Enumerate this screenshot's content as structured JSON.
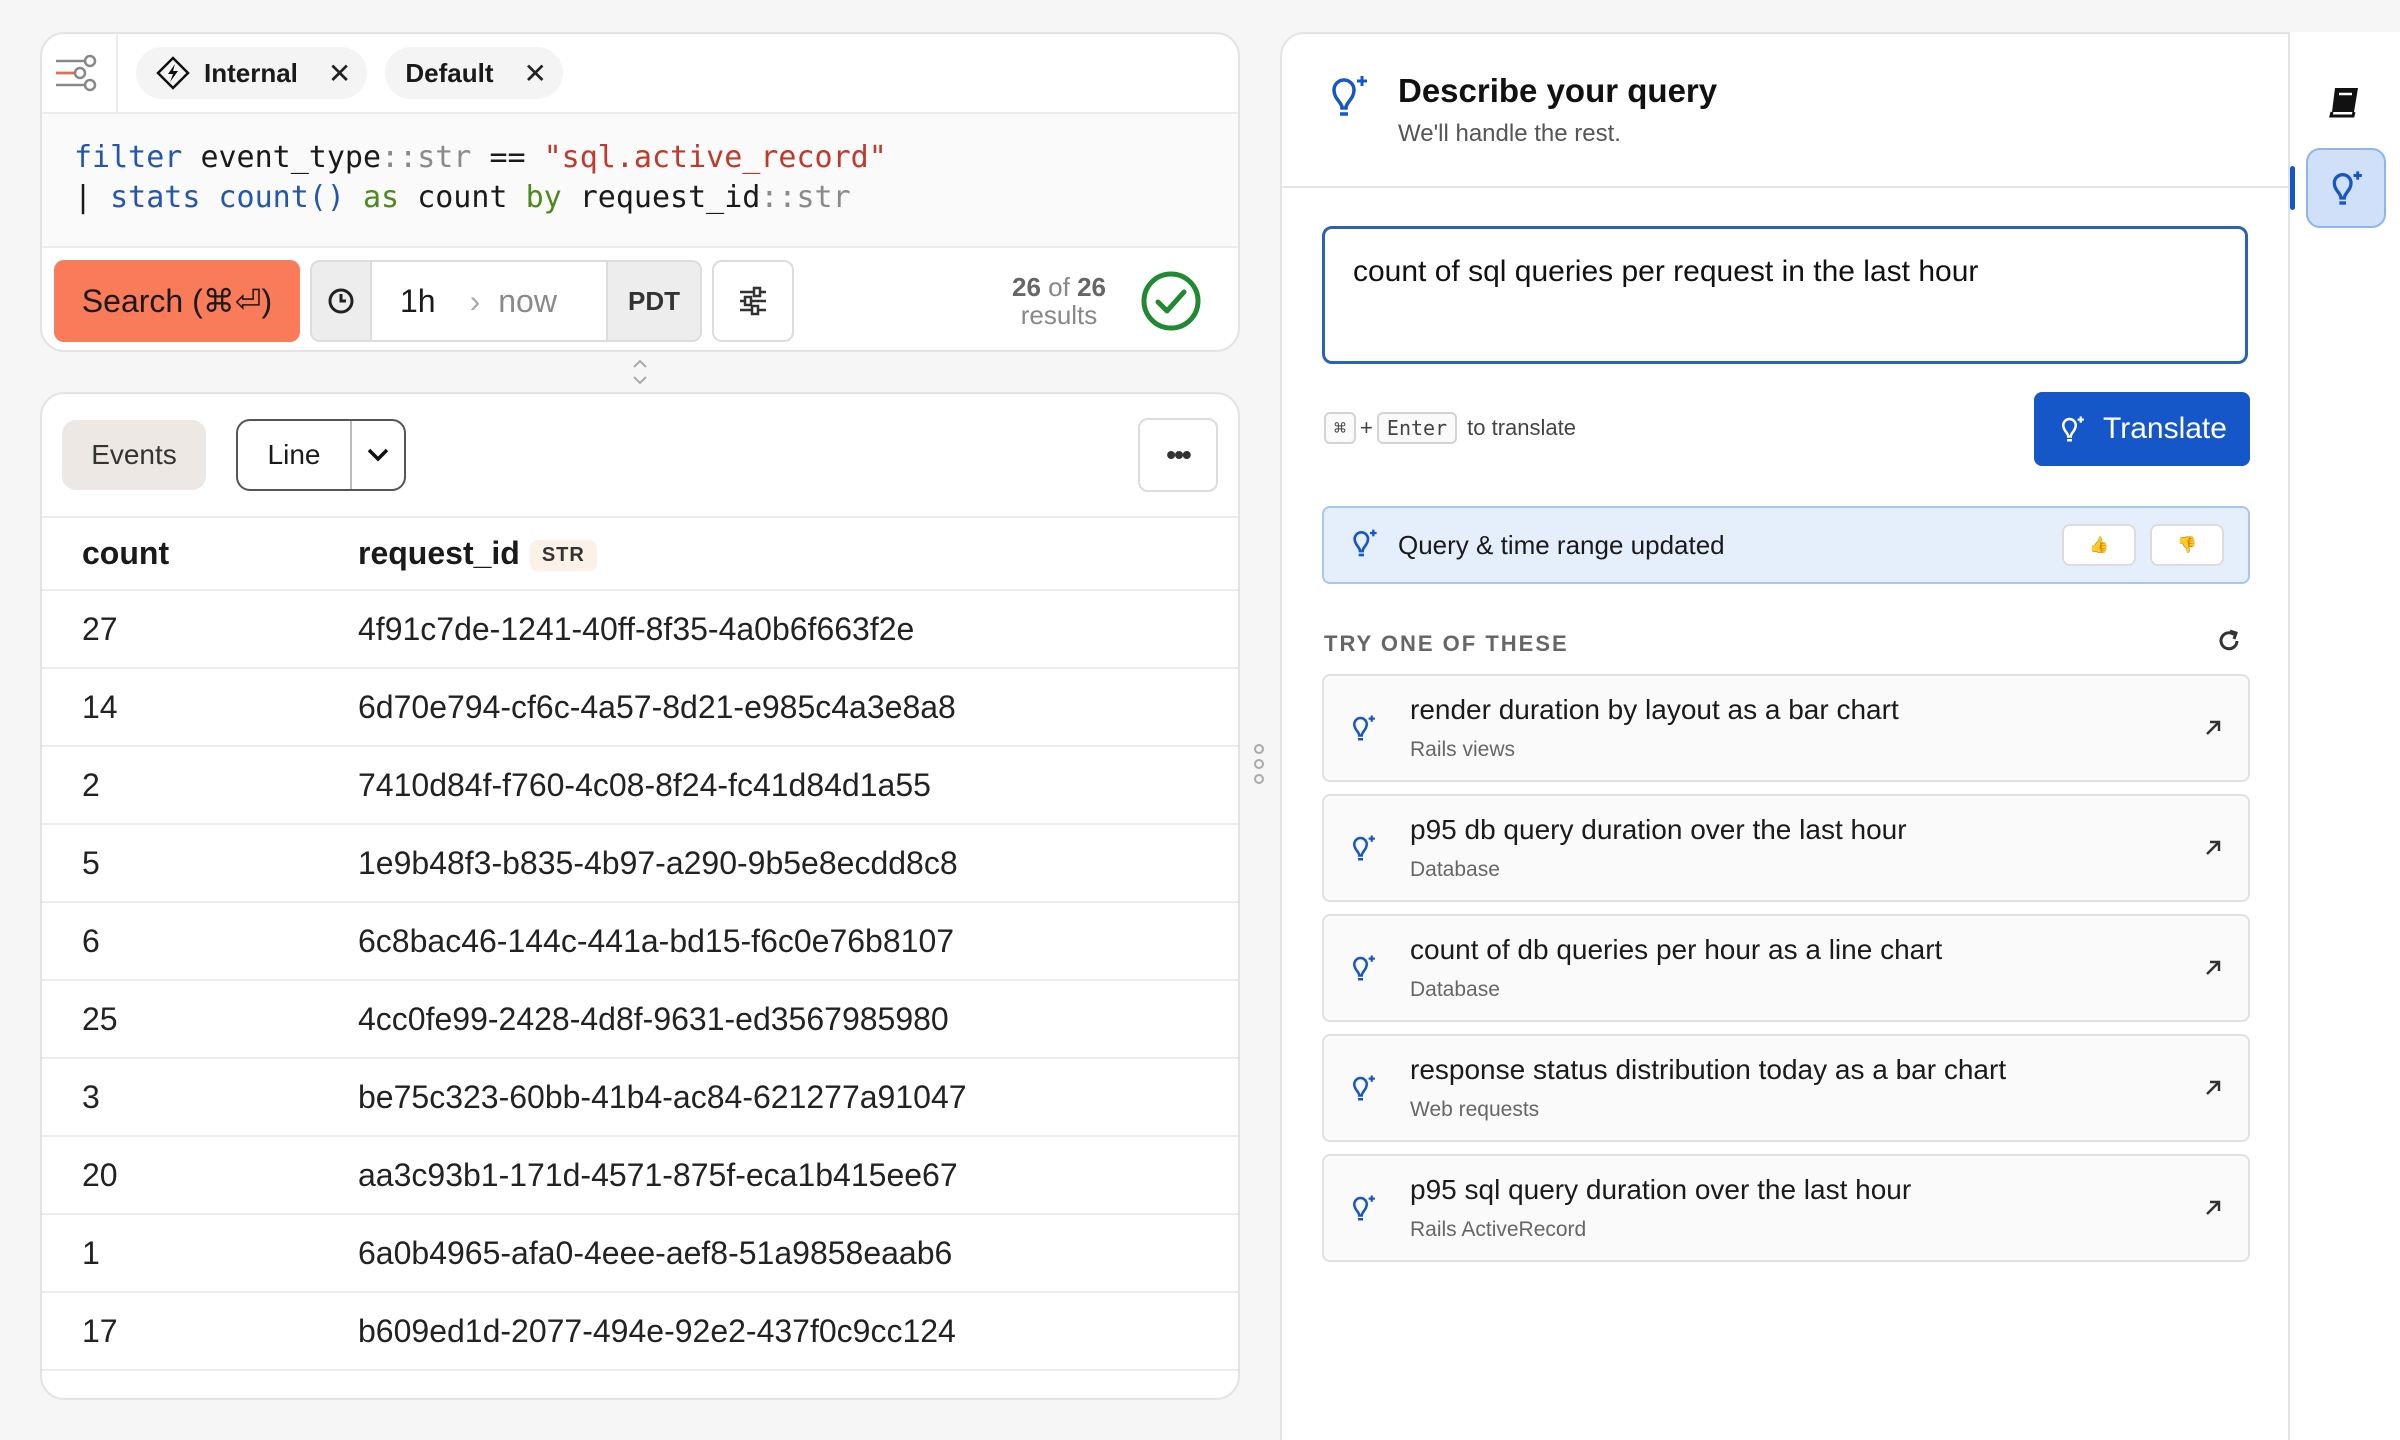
{
  "query": {
    "chips": [
      {
        "label": "Internal",
        "icon": "dataset-lightning-icon"
      },
      {
        "label": "Default"
      }
    ],
    "code": {
      "line1": {
        "kw": "filter",
        "field": "event_type",
        "sep": "::",
        "type": "str",
        "op": "==",
        "value": "\"sql.active_record\""
      },
      "line2": {
        "pipe": "|",
        "kw": "stats",
        "fn": "count()",
        "as": "as",
        "alias": "count",
        "by": "by",
        "field": "request_id",
        "sep": "::",
        "type": "str"
      }
    },
    "search_label": "Search (⌘⏎)",
    "time": {
      "start": "1h",
      "end": "now",
      "timezone": "PDT"
    },
    "results": {
      "shown": "26",
      "of": "of",
      "total": "26",
      "label": "results"
    }
  },
  "results_view": {
    "events_label": "Events",
    "viz_label": "Line",
    "more_label": "•••",
    "columns": [
      {
        "label": "count"
      },
      {
        "label": "request_id",
        "type": "STR"
      }
    ],
    "rows": [
      {
        "count": "27",
        "request_id": "4f91c7de-1241-40ff-8f35-4a0b6f663f2e"
      },
      {
        "count": "14",
        "request_id": "6d70e794-cf6c-4a57-8d21-e985c4a3e8a8"
      },
      {
        "count": "2",
        "request_id": "7410d84f-f760-4c08-8f24-fc41d84d1a55"
      },
      {
        "count": "5",
        "request_id": "1e9b48f3-b835-4b97-a290-9b5e8ecdd8c8"
      },
      {
        "count": "6",
        "request_id": "6c8bac46-144c-441a-bd15-f6c0e76b8107"
      },
      {
        "count": "25",
        "request_id": "4cc0fe99-2428-4d8f-9631-ed3567985980"
      },
      {
        "count": "3",
        "request_id": "be75c323-60bb-41b4-ac84-621277a91047"
      },
      {
        "count": "20",
        "request_id": "aa3c93b1-171d-4571-875f-eca1b415ee67"
      },
      {
        "count": "1",
        "request_id": "6a0b4965-afa0-4eee-aef8-51a9858eaab6"
      },
      {
        "count": "17",
        "request_id": "b609ed1d-2077-494e-92e2-437f0c9cc124"
      }
    ]
  },
  "assistant": {
    "title": "Describe your query",
    "subtitle": "We'll handle the rest.",
    "prompt": "count of sql queries per request in the last hour",
    "shortcut": {
      "key1": "⌘",
      "plus": "+",
      "key2": "Enter",
      "text": "to translate"
    },
    "translate_label": "Translate",
    "status": "Query & time range updated",
    "feedback": {
      "up": "👍",
      "down": "👎"
    },
    "suggest_heading": "TRY ONE OF THESE",
    "suggestions": [
      {
        "title": "render duration by layout as a bar chart",
        "category": "Rails views"
      },
      {
        "title": "p95 db query duration over the last hour",
        "category": "Database"
      },
      {
        "title": "count of db queries per hour as a line chart",
        "category": "Database"
      },
      {
        "title": "response status distribution today as a bar chart",
        "category": "Web requests"
      },
      {
        "title": "p95 sql query duration over the last hour",
        "category": "Rails ActiveRecord"
      }
    ]
  },
  "colors": {
    "accent": "#1557c9",
    "search": "#f97b5a",
    "success": "#1f8a32"
  }
}
